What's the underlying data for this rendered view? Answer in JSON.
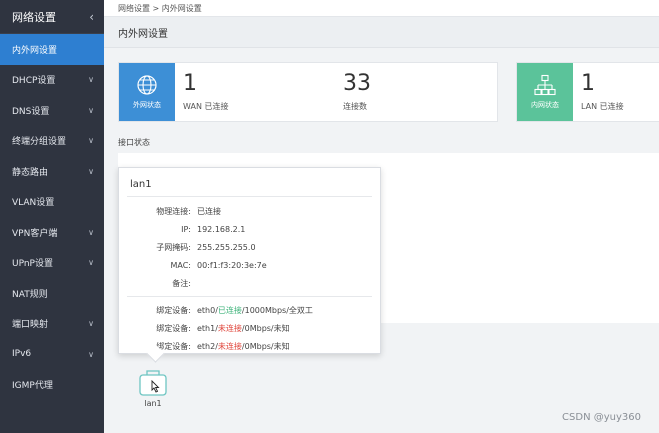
{
  "sidebar": {
    "title": "网络设置",
    "items": [
      {
        "label": "内外网设置",
        "active": true,
        "has_arrow": false
      },
      {
        "label": "DHCP设置",
        "has_arrow": true
      },
      {
        "label": "DNS设置",
        "has_arrow": true
      },
      {
        "label": "终端分组设置",
        "has_arrow": true
      },
      {
        "label": "静态路由",
        "has_arrow": true
      },
      {
        "label": "VLAN设置",
        "has_arrow": false
      },
      {
        "label": "VPN客户端",
        "has_arrow": true
      },
      {
        "label": "UPnP设置",
        "has_arrow": true
      },
      {
        "label": "NAT规则",
        "has_arrow": false
      },
      {
        "label": "端口映射",
        "has_arrow": true
      },
      {
        "label": "IPv6",
        "has_arrow": true
      },
      {
        "label": "IGMP代理",
        "has_arrow": false
      }
    ]
  },
  "breadcrumb": "网络设置 > 内外网设置",
  "page_title": "内外网设置",
  "wan_card": {
    "icon_label": "外网状态",
    "count": "1",
    "count_label": "WAN 已连接",
    "conn": "33",
    "conn_label": "连接数",
    "color": "#3d8fd6"
  },
  "lan_card": {
    "icon_label": "内网状态",
    "count": "1",
    "count_label": "LAN 已连接",
    "color": "#5bc39a"
  },
  "section_label": "接口状态",
  "popup": {
    "title": "lan1",
    "rows": [
      {
        "k": "物理连接:",
        "v": "已连接",
        "cls": "green"
      },
      {
        "k": "IP:",
        "v": "192.168.2.1"
      },
      {
        "k": "子网掩码:",
        "v": "255.255.255.0"
      },
      {
        "k": "MAC:",
        "v": "00:f1:f3:20:3e:7e"
      },
      {
        "k": "备注:",
        "v": ""
      }
    ],
    "devices": [
      {
        "k": "绑定设备:",
        "port": "eth0/",
        "state": "已连接",
        "state_cls": "green",
        "rest": "/1000Mbps/全双工"
      },
      {
        "k": "绑定设备:",
        "port": "eth1/",
        "state": "未连接",
        "state_cls": "red",
        "rest": "/0Mbps/未知"
      },
      {
        "k": "绑定设备:",
        "port": "eth2/",
        "state": "未连接",
        "state_cls": "red",
        "rest": "/0Mbps/未知"
      }
    ]
  },
  "lan_node_label": "lan1",
  "watermark": "CSDN @yuy360"
}
